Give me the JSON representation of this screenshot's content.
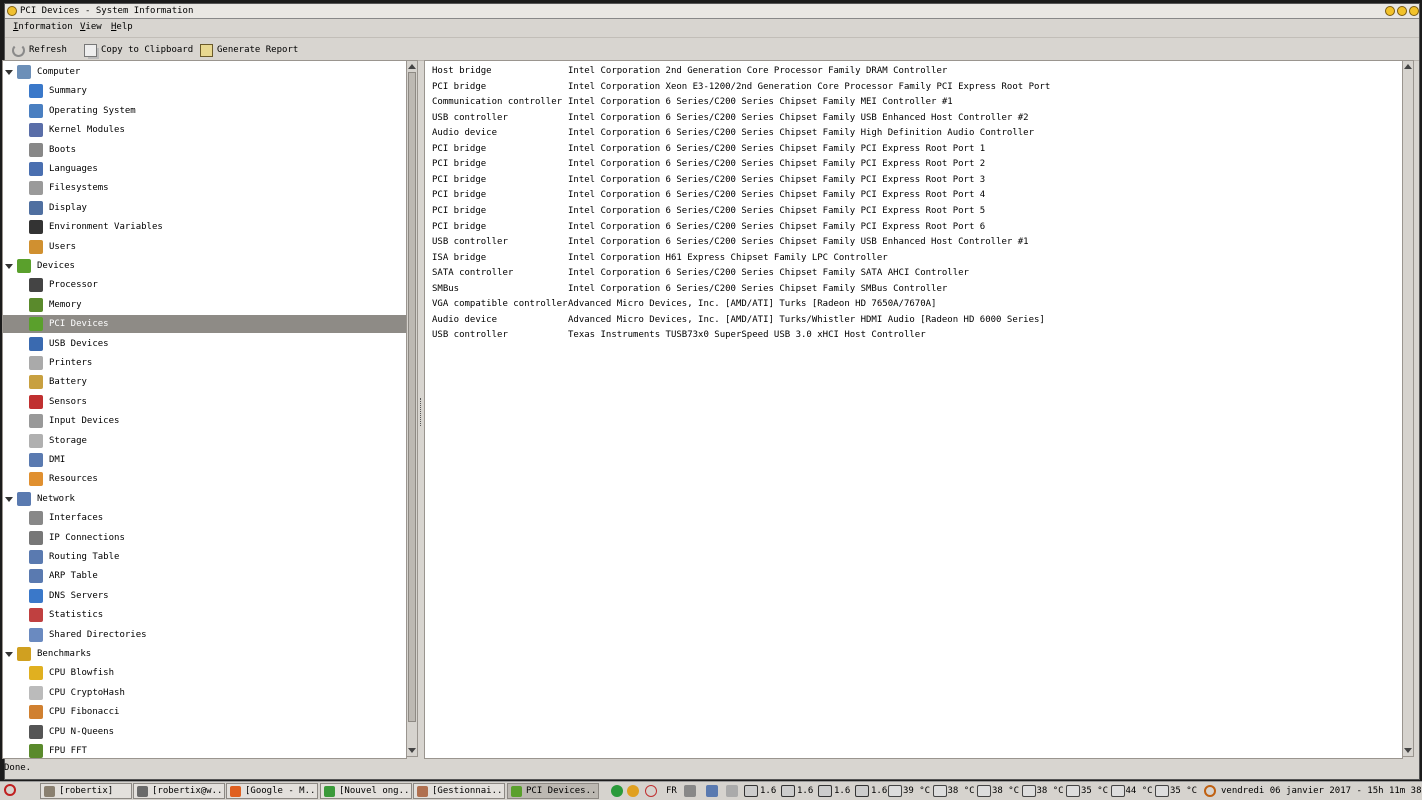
{
  "window": {
    "title": "PCI Devices - System Information"
  },
  "menu": {
    "information": "Information",
    "view": "View",
    "help": "Help"
  },
  "toolbar": {
    "refresh": "Refresh",
    "copy": "Copy to Clipboard",
    "report": "Generate Report"
  },
  "tree": [
    {
      "label": "Computer",
      "level": 0,
      "icon": "computer-icon",
      "color": "#6c8fb8"
    },
    {
      "label": "Summary",
      "level": 1,
      "icon": "info-icon",
      "color": "#3a78c9"
    },
    {
      "label": "Operating System",
      "level": 1,
      "icon": "gear-icon",
      "color": "#4a7fc1"
    },
    {
      "label": "Kernel Modules",
      "level": 1,
      "icon": "module-icon",
      "color": "#5a6ea8"
    },
    {
      "label": "Boots",
      "level": 1,
      "icon": "power-icon",
      "color": "#888888"
    },
    {
      "label": "Languages",
      "level": 1,
      "icon": "flag-icon",
      "color": "#4a6fb0"
    },
    {
      "label": "Filesystems",
      "level": 1,
      "icon": "drive-icon",
      "color": "#9a9a9a"
    },
    {
      "label": "Display",
      "level": 1,
      "icon": "monitor-icon",
      "color": "#4f6fa0"
    },
    {
      "label": "Environment Variables",
      "level": 1,
      "icon": "terminal-icon",
      "color": "#333333"
    },
    {
      "label": "Users",
      "level": 1,
      "icon": "users-icon",
      "color": "#d09030"
    },
    {
      "label": "Devices",
      "level": 0,
      "icon": "pci-card-icon",
      "color": "#5aa02c"
    },
    {
      "label": "Processor",
      "level": 1,
      "icon": "cpu-icon",
      "color": "#444444"
    },
    {
      "label": "Memory",
      "level": 1,
      "icon": "memory-icon",
      "color": "#5a8a2c"
    },
    {
      "label": "PCI Devices",
      "level": 1,
      "icon": "pci-card-icon",
      "color": "#5aa02c",
      "selected": true
    },
    {
      "label": "USB Devices",
      "level": 1,
      "icon": "usb-icon",
      "color": "#3a6ab0"
    },
    {
      "label": "Printers",
      "level": 1,
      "icon": "printer-icon",
      "color": "#aaaaaa"
    },
    {
      "label": "Battery",
      "level": 1,
      "icon": "battery-icon",
      "color": "#c8a040"
    },
    {
      "label": "Sensors",
      "level": 1,
      "icon": "thermometer-icon",
      "color": "#c03030"
    },
    {
      "label": "Input Devices",
      "level": 1,
      "icon": "keyboard-icon",
      "color": "#999999"
    },
    {
      "label": "Storage",
      "level": 1,
      "icon": "storage-icon",
      "color": "#b0b0b0"
    },
    {
      "label": "DMI",
      "level": 1,
      "icon": "dmi-icon",
      "color": "#5a7ab0"
    },
    {
      "label": "Resources",
      "level": 1,
      "icon": "resources-icon",
      "color": "#e09030"
    },
    {
      "label": "Network",
      "level": 0,
      "icon": "network-icon",
      "color": "#5a7ab0"
    },
    {
      "label": "Interfaces",
      "level": 1,
      "icon": "interfaces-icon",
      "color": "#888888"
    },
    {
      "label": "IP Connections",
      "level": 1,
      "icon": "ip-icon",
      "color": "#777777"
    },
    {
      "label": "Routing Table",
      "level": 1,
      "icon": "routing-icon",
      "color": "#5a7ab0"
    },
    {
      "label": "ARP Table",
      "level": 1,
      "icon": "arp-icon",
      "color": "#5a7ab0"
    },
    {
      "label": "DNS Servers",
      "level": 1,
      "icon": "dns-icon",
      "color": "#3a78c9"
    },
    {
      "label": "Statistics",
      "level": 1,
      "icon": "statistics-icon",
      "color": "#c04040"
    },
    {
      "label": "Shared Directories",
      "level": 1,
      "icon": "folder-icon",
      "color": "#6a8ac0"
    },
    {
      "label": "Benchmarks",
      "level": 0,
      "icon": "benchmark-icon",
      "color": "#d0a020"
    },
    {
      "label": "CPU Blowfish",
      "level": 1,
      "icon": "blowfish-icon",
      "color": "#e0b020"
    },
    {
      "label": "CPU CryptoHash",
      "level": 1,
      "icon": "crypto-icon",
      "color": "#bbbbbb"
    },
    {
      "label": "CPU Fibonacci",
      "level": 1,
      "icon": "fibonacci-icon",
      "color": "#d08030"
    },
    {
      "label": "CPU N-Queens",
      "level": 1,
      "icon": "queens-icon",
      "color": "#555555"
    },
    {
      "label": "FPU FFT",
      "level": 1,
      "icon": "fft-icon",
      "color": "#5a8a2c"
    }
  ],
  "devices": [
    {
      "type": "Host bridge",
      "name": "Intel Corporation 2nd Generation Core Processor Family DRAM Controller"
    },
    {
      "type": "PCI bridge",
      "name": "Intel Corporation Xeon E3-1200/2nd Generation Core Processor Family PCI Express Root Port"
    },
    {
      "type": "Communication controller",
      "name": "Intel Corporation 6 Series/C200 Series Chipset Family MEI Controller #1"
    },
    {
      "type": "USB controller",
      "name": "Intel Corporation 6 Series/C200 Series Chipset Family USB Enhanced Host Controller #2"
    },
    {
      "type": "Audio device",
      "name": "Intel Corporation 6 Series/C200 Series Chipset Family High Definition Audio Controller"
    },
    {
      "type": "PCI bridge",
      "name": "Intel Corporation 6 Series/C200 Series Chipset Family PCI Express Root Port 1"
    },
    {
      "type": "PCI bridge",
      "name": "Intel Corporation 6 Series/C200 Series Chipset Family PCI Express Root Port 2"
    },
    {
      "type": "PCI bridge",
      "name": "Intel Corporation 6 Series/C200 Series Chipset Family PCI Express Root Port 3"
    },
    {
      "type": "PCI bridge",
      "name": "Intel Corporation 6 Series/C200 Series Chipset Family PCI Express Root Port 4"
    },
    {
      "type": "PCI bridge",
      "name": "Intel Corporation 6 Series/C200 Series Chipset Family PCI Express Root Port 5"
    },
    {
      "type": "PCI bridge",
      "name": "Intel Corporation 6 Series/C200 Series Chipset Family PCI Express Root Port 6"
    },
    {
      "type": "USB controller",
      "name": "Intel Corporation 6 Series/C200 Series Chipset Family USB Enhanced Host Controller #1"
    },
    {
      "type": "ISA bridge",
      "name": "Intel Corporation H61 Express Chipset Family LPC Controller"
    },
    {
      "type": "SATA controller",
      "name": "Intel Corporation 6 Series/C200 Series Chipset Family SATA AHCI Controller"
    },
    {
      "type": "SMBus",
      "name": "Intel Corporation 6 Series/C200 Series Chipset Family SMBus Controller"
    },
    {
      "type": "VGA compatible controller",
      "name": "Advanced Micro Devices, Inc. [AMD/ATI] Turks [Radeon HD 7650A/7670A]"
    },
    {
      "type": "Audio device",
      "name": "Advanced Micro Devices, Inc. [AMD/ATI] Turks/Whistler HDMI Audio [Radeon HD 6000 Series]"
    },
    {
      "type": "USB controller",
      "name": "Texas Instruments TUSB73x0 SuperSpeed USB 3.0 xHCI Host Controller"
    }
  ],
  "status": "Done.",
  "taskbar": {
    "tasks": [
      {
        "label": "[robertix]",
        "icon": "folder-icon",
        "color": "#8a8070"
      },
      {
        "label": "[robertix@w...",
        "icon": "terminal-icon",
        "color": "#6a6a6a"
      },
      {
        "label": "[Google - M...",
        "icon": "firefox-icon",
        "color": "#e06020"
      },
      {
        "label": "[Nouvel ong...",
        "icon": "chrome-icon",
        "color": "#3a9a3a"
      },
      {
        "label": "[Gestionnai...",
        "icon": "package-icon",
        "color": "#b07050"
      },
      {
        "label": "PCI Devices...",
        "icon": "pci-card-icon",
        "color": "#5aa02c",
        "active": true
      }
    ],
    "tray": {
      "lang": "FR",
      "loads": [
        "1.6",
        "1.6",
        "1.6",
        "1.6"
      ],
      "temps": [
        "39 °C",
        "38 °C",
        "38 °C",
        "38 °C",
        "35 °C",
        "44 °C",
        "35 °C"
      ],
      "clock": "vendredi 06 janvier 2017 - 15h 11m 38s"
    }
  },
  "colors": {
    "selection": "#8e8b86",
    "window_bg": "#d8d5d0",
    "button": "#f2c22a"
  }
}
